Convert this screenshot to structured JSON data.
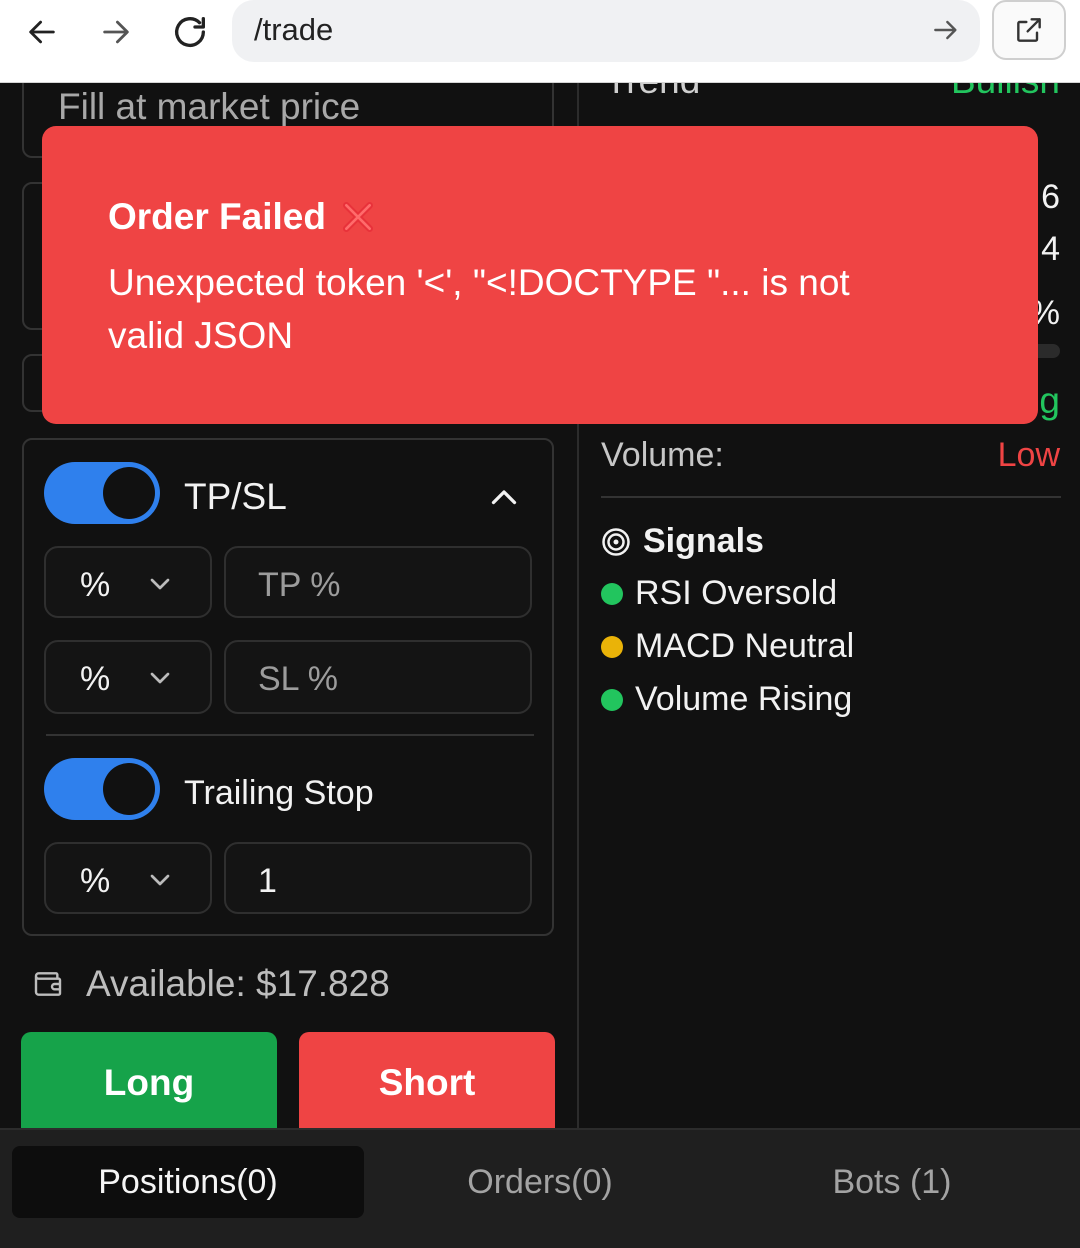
{
  "browser": {
    "url": "/trade"
  },
  "order_form": {
    "market_price_text": "Fill at market price",
    "tpsl_label": "TP/SL",
    "tp_unit": "%",
    "tp_placeholder": "TP %",
    "sl_unit": "%",
    "sl_placeholder": "SL %",
    "trailing_label": "Trailing Stop",
    "trailing_unit": "%",
    "trailing_value": "1",
    "available_text": "Available: $17.828",
    "long_label": "Long",
    "short_label": "Short"
  },
  "analysis": {
    "trend_label": "Trend",
    "trend_value": "Bullish",
    "partial_values": [
      "6",
      "4",
      "%"
    ],
    "partial_green": "g",
    "volume_label": "Volume:",
    "volume_value": "Low",
    "signals_title": "Signals",
    "signals": [
      {
        "text": "RSI Oversold",
        "color": "#22c55e"
      },
      {
        "text": "MACD Neutral",
        "color": "#eab308"
      },
      {
        "text": "Volume Rising",
        "color": "#22c55e"
      }
    ]
  },
  "tabs": [
    {
      "label": "Positions(0)",
      "active": true
    },
    {
      "label": "Orders(0)",
      "active": false
    },
    {
      "label": "Bots (1)",
      "active": false
    }
  ],
  "toast": {
    "title": "Order Failed",
    "message": "Unexpected token '<', \"<!DOCTYPE \"... is not valid JSON"
  },
  "colors": {
    "accent_blue": "#2f80ed",
    "long_green": "#16a34a",
    "short_red": "#ef4444",
    "toast_red": "#ef4444",
    "bullish_green": "#22c55e"
  }
}
